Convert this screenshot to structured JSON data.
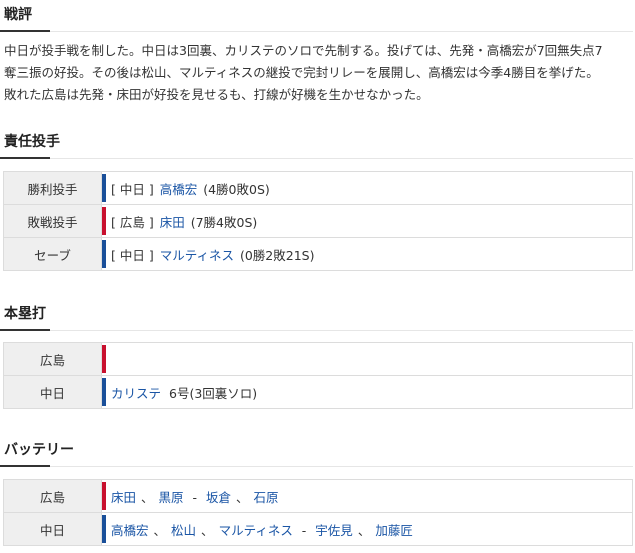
{
  "review": {
    "heading": "戦評",
    "lines": [
      "中日が投手戦を制した。中日は3回裏、カリステのソロで先制する。投げては、先発・高橋宏が7回無失点7",
      "奪三振の好投。その後は松山、マルティネスの継投で完封リレーを展開し、高橋宏は今季4勝目を挙げた。",
      "敗れた広島は先発・床田が好投を見せるも、打線が好機を生かせなかった。"
    ]
  },
  "pitchers": {
    "heading": "責任投手",
    "rows": [
      {
        "label": "勝利投手",
        "team": "[ 中日 ]",
        "name": "高橋宏",
        "record": "(4勝0敗0S)",
        "bar_color": "#1a4f99"
      },
      {
        "label": "敗戦投手",
        "team": "[ 広島 ]",
        "name": "床田",
        "record": "(7勝4敗0S)",
        "bar_color": "#c8102e"
      },
      {
        "label": "セーブ",
        "team": "[ 中日 ]",
        "name": "マルティネス",
        "record": "(0勝2敗21S)",
        "bar_color": "#1a4f99"
      }
    ]
  },
  "homeruns": {
    "heading": "本塁打",
    "rows": [
      {
        "label": "広島",
        "name": "",
        "detail": "",
        "bar_color": "#c8102e"
      },
      {
        "label": "中日",
        "name": "カリステ",
        "detail": "6号(3回裏ソロ)",
        "bar_color": "#1a4f99"
      }
    ]
  },
  "battery": {
    "heading": "バッテリー",
    "rows": [
      {
        "label": "広島",
        "pitchers": [
          "床田",
          "黒原"
        ],
        "catchers": [
          "坂倉",
          "石原"
        ],
        "bar_color": "#c8102e"
      },
      {
        "label": "中日",
        "pitchers": [
          "高橋宏",
          "松山",
          "マルティネス"
        ],
        "catchers": [
          "宇佐見",
          "加藤匠"
        ],
        "bar_color": "#1a4f99"
      }
    ]
  }
}
